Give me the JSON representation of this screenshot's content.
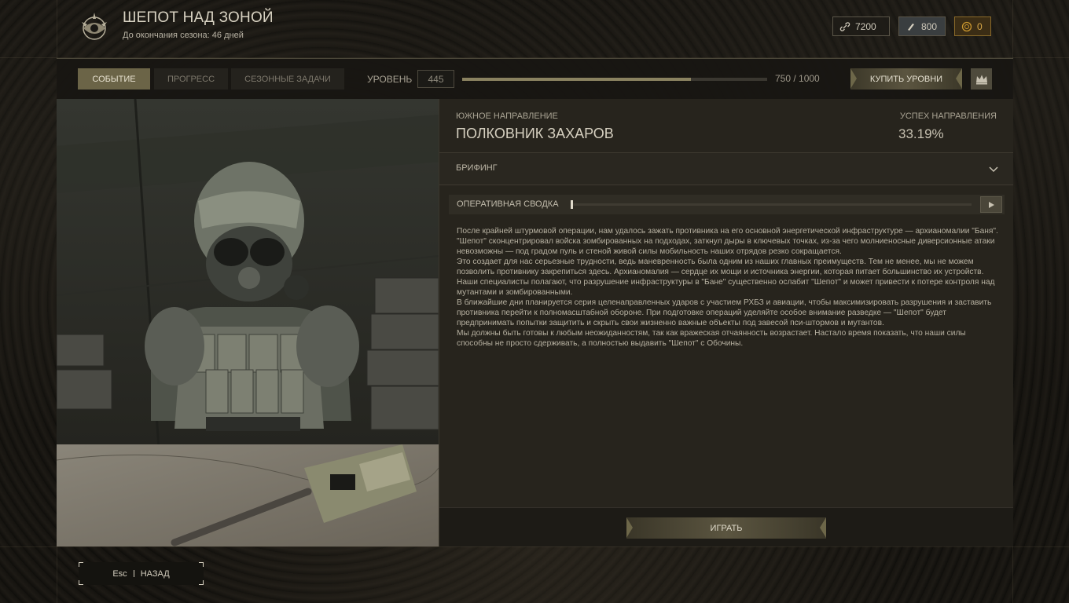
{
  "header": {
    "title": "ШЕПОТ НАД ЗОНОЙ",
    "subtitle": "До окончания сезона: 46 дней",
    "logo_icon": "faction-emblem-icon"
  },
  "currencies": [
    {
      "icon": "link-icon",
      "value": "7200"
    },
    {
      "icon": "ammo-icon",
      "value": "800"
    },
    {
      "icon": "coin-icon",
      "value": "0",
      "color": "#c9962e"
    }
  ],
  "topbar": {
    "tabs": [
      {
        "label": "СОБЫТИЕ",
        "active": true
      },
      {
        "label": "ПРОГРЕСС",
        "active": false
      },
      {
        "label": "СЕЗОННЫЕ ЗАДАЧИ",
        "active": false
      }
    ],
    "level_label": "УРОВЕНЬ",
    "level_value": "445",
    "progress_current": 750,
    "progress_max": 1000,
    "progress_text": "750 / 1000",
    "buy_levels_label": "КУПИТЬ УРОВНИ",
    "crown_icon": "crown-icon"
  },
  "direction": {
    "label": "ЮЖНОЕ НАПРАВЛЕНИЕ",
    "name": "ПОЛКОВНИК ЗАХАРОВ",
    "success_label": "УСПЕХ НАПРАВЛЕНИЯ",
    "success_value": "33.19%"
  },
  "briefing": {
    "label": "БРИФИНГ",
    "audio_label": "ОПЕРАТИВНАЯ СВОДКА",
    "audio_progress": 0,
    "paragraphs": [
      "После крайней штурмовой операции, нам удалось зажать противника на его основной энергетической инфраструктуре — архианомалии \"Баня\". \"Шепот\" сконцентрировал войска зомбированных на подходах, заткнул дыры в ключевых точках, из-за чего молниеносные диверсионные атаки невозможны — под градом пуль и стеной живой силы мобильность наших отрядов резко сокращается.",
      "Это создает для нас серьезные трудности, ведь маневренность была одним из наших главных преимуществ. Тем не менее, мы не можем позволить противнику закрепиться здесь. Архианомалия — сердце их мощи и источника энергии, которая питает большинство их устройств. Наши специалисты полагают, что разрушение инфраструктуры в \"Бане\" существенно ослабит \"Шепот\" и может привести к потере контроля над мутантами и зомбированными.",
      "В ближайшие дни планируется серия целенаправленных ударов с участием РХБЗ и авиации, чтобы максимизировать разрушения и заставить противника перейти к полномасштабной обороне. При подготовке операций уделяйте особое внимание разведке — \"Шепот\" будет предпринимать попытки защитить и скрыть свои жизненно важные объекты под завесой пси-штормов и мутантов.",
      "Мы должны быть готовы к любым неожиданностям, так как вражеская отчаянность возрастает. Настало время показать, что наши силы способны не просто сдерживать, а полностью выдавить \"Шепот\" с Обочины."
    ]
  },
  "play_label": "ИГРАТЬ",
  "back": {
    "key": "Esc",
    "label": "НАЗАД"
  }
}
